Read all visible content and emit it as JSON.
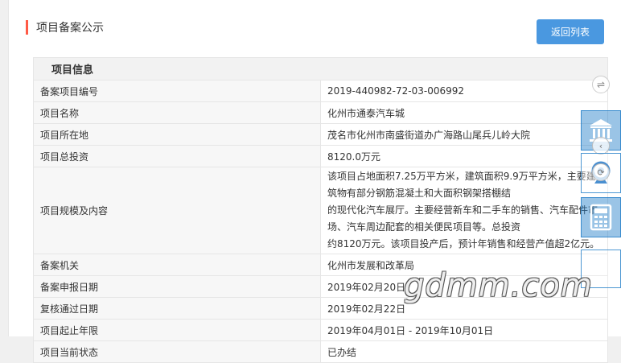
{
  "page": {
    "title": "项目备案公示",
    "back_button": "返回列表"
  },
  "section": {
    "header": "项目信息",
    "rows": [
      {
        "label": "备案项目编号",
        "value": "2019-440982-72-03-006992"
      },
      {
        "label": "项目名称",
        "value": "化州市通泰汽车城"
      },
      {
        "label": "项目所在地",
        "value": "茂名市化州市南盛街道办广海路山尾兵儿岭大院"
      },
      {
        "label": "项目总投资",
        "value": "8120.0万元"
      },
      {
        "label": "项目规模及内容",
        "value_lines": [
          "该项目占地面积7.25万平方米，建筑面积9.9万平方米，主要建筑物有部分钢筋混凝土和大面积钢架搭棚结",
          "的现代化汽车展厅。主要经营新车和二手车的销售、汽车配件市场、汽车周边配套的相关便民项目等。总投资",
          "约8120万元。该项目投产后，预计年销售和经营产值超2亿元。"
        ]
      },
      {
        "label": "备案机关",
        "value": "化州市发展和改革局"
      },
      {
        "label": "备案申报日期",
        "value": "2019年02月20日"
      },
      {
        "label": "复核通过日期",
        "value": "2019年02月22日"
      },
      {
        "label": "项目起止年限",
        "value": "2019年04月01日 - 2019年10月01日"
      },
      {
        "label": "项目当前状态",
        "value": "已办结"
      }
    ]
  },
  "watermark": "gdmm.com",
  "icons": {
    "swap": "swap-arrows-icon",
    "building": "government-building-icon",
    "webcam": "webcam-icon",
    "calculator": "calculator-icon"
  },
  "colors": {
    "accent": "#ff5a46",
    "button": "#4a98e0",
    "side_blue": "#207dc8"
  }
}
